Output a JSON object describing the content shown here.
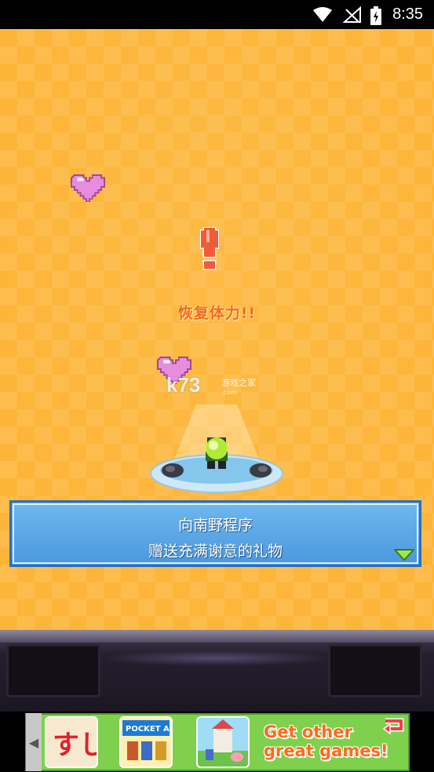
{
  "status_bar": {
    "time": "8:35"
  },
  "game": {
    "recover_text": "恢复体力!!",
    "watermark": {
      "brand": "k73",
      "site": "游戏之家",
      "url": ".com"
    }
  },
  "dialog": {
    "line1": "向南野程序",
    "line2": "赠送充满谢意的礼物"
  },
  "ad": {
    "text_line1": "Get other",
    "text_line2": "great games!",
    "tiles": [
      {
        "label": "すし"
      },
      {
        "label": "POCKET ACAD"
      },
      {
        "label": ""
      }
    ]
  },
  "colors": {
    "background": "#fdb73a",
    "dialog": "#4a98de",
    "recover_text": "#f26a17",
    "ad_bg": "#7fd14d"
  }
}
